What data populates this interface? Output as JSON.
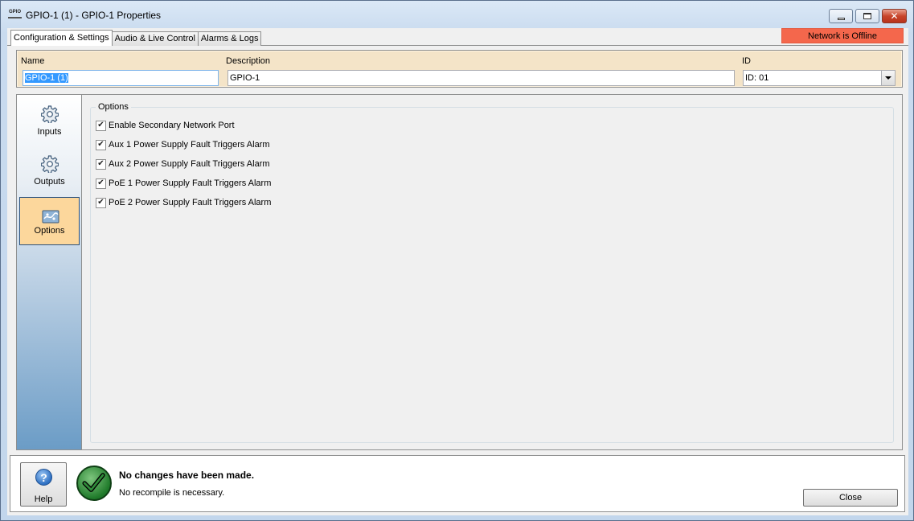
{
  "window": {
    "title": "GPIO-1 (1) - GPIO-1 Properties",
    "app_icon_text": "GPIO"
  },
  "tabs": [
    {
      "label": "Configuration & Settings",
      "active": true
    },
    {
      "label": "Audio & Live Control",
      "active": false
    },
    {
      "label": "Alarms & Logs",
      "active": false
    }
  ],
  "network_status": {
    "text": "Network is Offline",
    "color": "#f4674c"
  },
  "fields": {
    "name_label": "Name",
    "name_value": "GPIO-1 (1)",
    "description_label": "Description",
    "description_value": "GPIO-1",
    "id_label": "ID",
    "id_value": "ID: 01"
  },
  "nav": [
    {
      "label": "Inputs",
      "icon": "gear-icon",
      "selected": false
    },
    {
      "label": "Outputs",
      "icon": "gear-icon",
      "selected": false
    },
    {
      "label": "Options",
      "icon": "options-icon",
      "selected": true
    }
  ],
  "options": {
    "group_label": "Options",
    "items": [
      {
        "label": "Enable Secondary Network Port",
        "checked": true
      },
      {
        "label": "Aux 1 Power Supply Fault Triggers Alarm",
        "checked": true
      },
      {
        "label": "Aux 2 Power Supply Fault Triggers Alarm",
        "checked": true
      },
      {
        "label": "PoE 1 Power Supply Fault Triggers Alarm",
        "checked": true
      },
      {
        "label": "PoE 2 Power Supply Fault Triggers Alarm",
        "checked": true
      }
    ]
  },
  "status": {
    "help_label": "Help",
    "help_icon": "question-icon",
    "title": "No changes have been made.",
    "subtitle": "No recompile is necessary.",
    "close_label": "Close"
  }
}
